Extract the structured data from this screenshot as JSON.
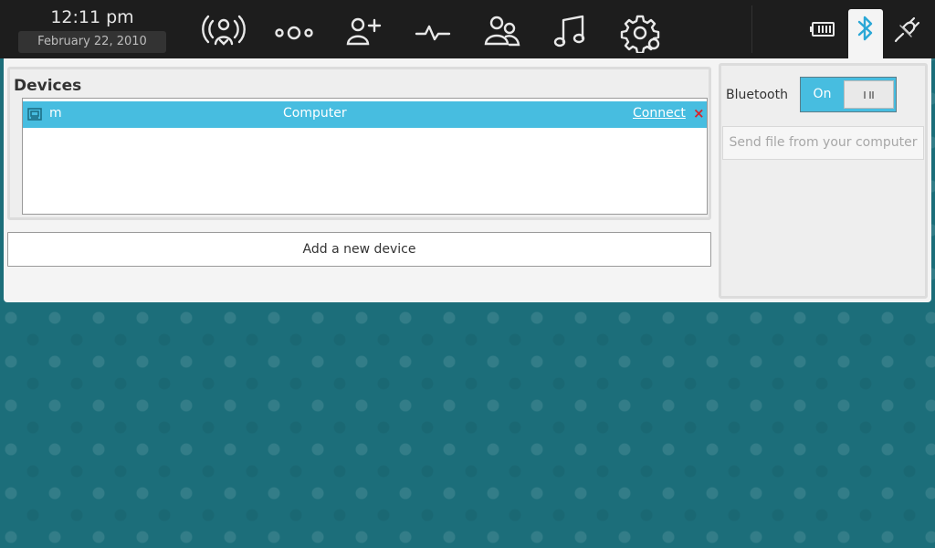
{
  "clock": {
    "time": "12:11 pm",
    "date": "February 22, 2010"
  },
  "nav": {
    "icons": [
      "wireless-icon",
      "applications-icon",
      "add-contact-icon",
      "activity-icon",
      "people-icon",
      "music-icon",
      "settings-icon"
    ]
  },
  "status": {
    "icons": [
      "battery-icon",
      "bluetooth-icon",
      "power-plug-icon"
    ],
    "accent": "#47bde0"
  },
  "devices": {
    "title": "Devices",
    "rows": [
      {
        "name": "m",
        "type": "Computer",
        "action": "Connect",
        "remove": "×"
      }
    ],
    "add_label": "Add a new device"
  },
  "bluetooth": {
    "label": "Bluetooth",
    "toggle_label": "On",
    "send_label": "Send file from your computer"
  }
}
